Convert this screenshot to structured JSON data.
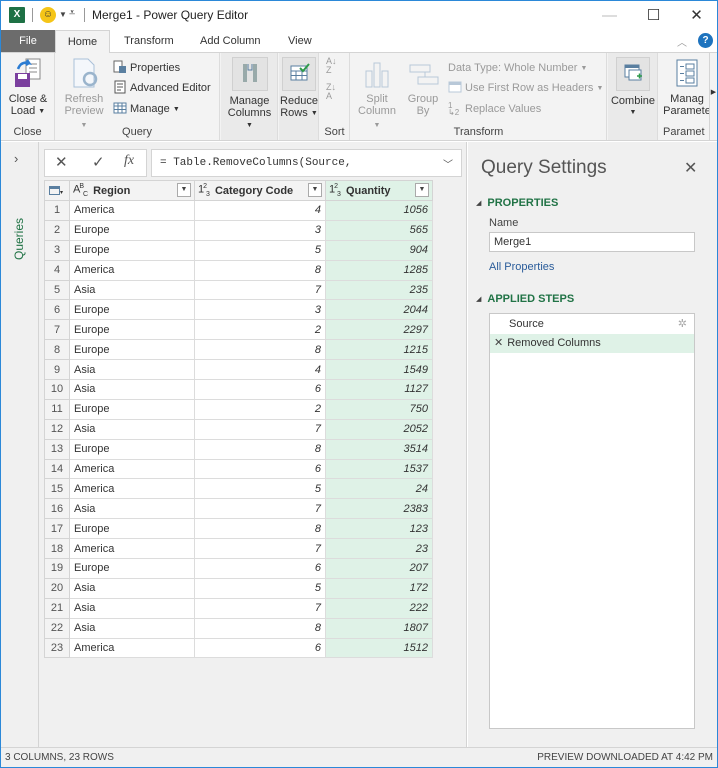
{
  "window": {
    "title": "Merge1 - Power Query Editor",
    "app_icon": "excel-icon",
    "qat_icon": "smiley-feedback-icon",
    "controls": [
      "minimize",
      "maximize",
      "close"
    ]
  },
  "tabs": [
    {
      "label": "File",
      "active": false
    },
    {
      "label": "Home",
      "active": true
    },
    {
      "label": "Transform",
      "active": false
    },
    {
      "label": "Add Column",
      "active": false
    },
    {
      "label": "View",
      "active": false
    }
  ],
  "ribbon": {
    "close_group": {
      "label": "Close",
      "close_load": "Close &",
      "close_load2": "Load"
    },
    "query_group": {
      "label": "Query",
      "refresh": "Refresh",
      "refresh2": "Preview",
      "properties": "Properties",
      "advanced_editor": "Advanced Editor",
      "manage": "Manage"
    },
    "manage_columns": {
      "line1": "Manage",
      "line2": "Columns"
    },
    "reduce_rows": {
      "line1": "Reduce",
      "line2": "Rows"
    },
    "sort_group": {
      "label": "Sort",
      "asc": "A→Z",
      "desc": "Z→A"
    },
    "transform_group": {
      "label": "Transform",
      "split_column": "Split",
      "split_column2": "Column",
      "group_by": "Group",
      "group_by2": "By",
      "data_type": "Data Type: Whole Number",
      "first_row_headers": "Use First Row as Headers",
      "replace_values": "Replace Values"
    },
    "combine_group": {
      "label": "",
      "combine": "Combine"
    },
    "parameters_group": {
      "label": "Paramet",
      "manage": "Manag",
      "manage2": "Paramete"
    }
  },
  "queries_pane": {
    "label": "Queries"
  },
  "formula_bar": {
    "formula": "= Table.RemoveColumns(Source,",
    "fx_label": "fx"
  },
  "grid": {
    "columns": [
      {
        "name": "Region",
        "type": "text",
        "type_icon": "ABC"
      },
      {
        "name": "Category Code",
        "type": "number",
        "type_icon": "123"
      },
      {
        "name": "Quantity",
        "type": "number",
        "type_icon": "123",
        "selected": true
      }
    ],
    "rows": [
      {
        "n": "1",
        "region": "America",
        "cat": "4",
        "qty": "1056"
      },
      {
        "n": "2",
        "region": "Europe",
        "cat": "3",
        "qty": "565"
      },
      {
        "n": "3",
        "region": "Europe",
        "cat": "5",
        "qty": "904"
      },
      {
        "n": "4",
        "region": "America",
        "cat": "8",
        "qty": "1285"
      },
      {
        "n": "5",
        "region": "Asia",
        "cat": "7",
        "qty": "235"
      },
      {
        "n": "6",
        "region": "Europe",
        "cat": "3",
        "qty": "2044"
      },
      {
        "n": "7",
        "region": "Europe",
        "cat": "2",
        "qty": "2297"
      },
      {
        "n": "8",
        "region": "Europe",
        "cat": "8",
        "qty": "1215"
      },
      {
        "n": "9",
        "region": "Asia",
        "cat": "4",
        "qty": "1549"
      },
      {
        "n": "10",
        "region": "Asia",
        "cat": "6",
        "qty": "1127"
      },
      {
        "n": "11",
        "region": "Europe",
        "cat": "2",
        "qty": "750"
      },
      {
        "n": "12",
        "region": "Asia",
        "cat": "7",
        "qty": "2052"
      },
      {
        "n": "13",
        "region": "Europe",
        "cat": "8",
        "qty": "3514"
      },
      {
        "n": "14",
        "region": "America",
        "cat": "6",
        "qty": "1537"
      },
      {
        "n": "15",
        "region": "America",
        "cat": "5",
        "qty": "24"
      },
      {
        "n": "16",
        "region": "Asia",
        "cat": "7",
        "qty": "2383"
      },
      {
        "n": "17",
        "region": "Europe",
        "cat": "8",
        "qty": "123"
      },
      {
        "n": "18",
        "region": "America",
        "cat": "7",
        "qty": "23"
      },
      {
        "n": "19",
        "region": "Europe",
        "cat": "6",
        "qty": "207"
      },
      {
        "n": "20",
        "region": "Asia",
        "cat": "5",
        "qty": "172"
      },
      {
        "n": "21",
        "region": "Asia",
        "cat": "7",
        "qty": "222"
      },
      {
        "n": "22",
        "region": "Asia",
        "cat": "8",
        "qty": "1807"
      },
      {
        "n": "23",
        "region": "America",
        "cat": "6",
        "qty": "1512"
      }
    ]
  },
  "query_settings": {
    "title": "Query Settings",
    "properties_heading": "PROPERTIES",
    "name_label": "Name",
    "name_value": "Merge1",
    "all_properties": "All Properties",
    "applied_steps_heading": "APPLIED STEPS",
    "steps": [
      {
        "label": "Source",
        "has_gear": true,
        "selected": false
      },
      {
        "label": "Removed Columns",
        "has_gear": false,
        "selected": true
      }
    ]
  },
  "status": {
    "left": "3 COLUMNS, 23 ROWS",
    "right": "PREVIEW DOWNLOADED AT 4:42 PM"
  },
  "colors": {
    "accent_green": "#217346",
    "selected_column": "#dff2e7",
    "window_border": "#2b88d8",
    "file_tab": "#6c6c6c"
  }
}
